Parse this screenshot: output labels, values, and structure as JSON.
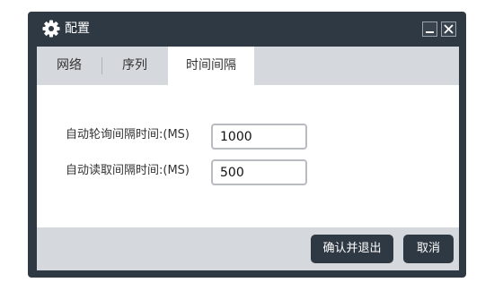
{
  "window": {
    "title": "配置",
    "icon": "gear-icon",
    "minimize_icon": "minimize-icon",
    "close_icon": "close-icon"
  },
  "tabs": [
    {
      "label": "网络",
      "selected": false
    },
    {
      "label": "序列",
      "selected": false
    },
    {
      "label": "时间间隔",
      "selected": true
    }
  ],
  "fields": {
    "poll_interval": {
      "label": "自动轮询间隔时间:(MS)",
      "value": "1000"
    },
    "read_interval": {
      "label": "自动读取间隔时间:(MS)",
      "value": "500"
    }
  },
  "buttons": {
    "confirm_exit": "确认并退出",
    "cancel": "取消"
  },
  "colors": {
    "window_frame": "#2f3943",
    "tab_bar": "#d5d9de",
    "button_bg": "#2f3943",
    "button_text": "#ffffff"
  }
}
